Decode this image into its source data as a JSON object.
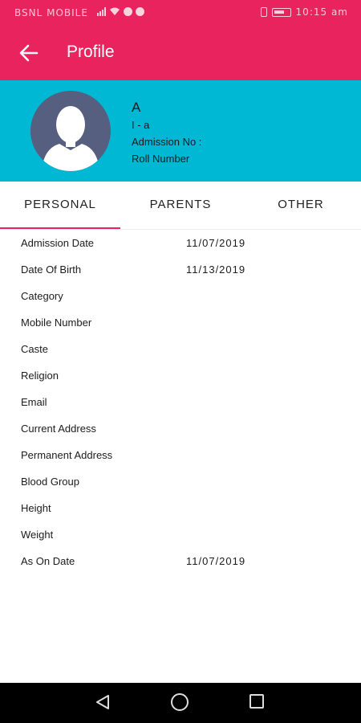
{
  "status_bar": {
    "carrier": "BSNL MOBILE",
    "time": "10:15 am",
    "icons": [
      "signal-icon",
      "wifi-icon",
      "chat-icon",
      "whatsapp-icon",
      "vibrate-icon",
      "battery-icon"
    ]
  },
  "app_bar": {
    "title": "Profile",
    "back_icon": "arrow-left-icon",
    "color": "#e8235e"
  },
  "profile": {
    "name": "A",
    "class_section": "I - a",
    "admission_no": "Admission No :",
    "roll_number": "Roll Number",
    "avatar_icon": "user-silhouette-icon",
    "header_color": "#00b8d4"
  },
  "tabs": [
    {
      "label": "PERSONAL",
      "selected": true
    },
    {
      "label": "PARENTS",
      "selected": false
    },
    {
      "label": "OTHER",
      "selected": false
    }
  ],
  "fields": [
    {
      "label": "Admission Date",
      "value": "11/07/2019"
    },
    {
      "label": "Date Of Birth",
      "value": "11/13/2019"
    },
    {
      "label": "Category",
      "value": ""
    },
    {
      "label": "Mobile Number",
      "value": ""
    },
    {
      "label": "Caste",
      "value": ""
    },
    {
      "label": "Religion",
      "value": ""
    },
    {
      "label": "Email",
      "value": ""
    },
    {
      "label": "Current Address",
      "value": ""
    },
    {
      "label": "Permanent Address",
      "value": ""
    },
    {
      "label": "Blood Group",
      "value": ""
    },
    {
      "label": "Height",
      "value": ""
    },
    {
      "label": "Weight",
      "value": ""
    },
    {
      "label": "As On Date",
      "value": "11/07/2019"
    }
  ],
  "nav_bar": {
    "icons": [
      "triangle-back-icon",
      "circle-home-icon",
      "square-recents-icon"
    ]
  }
}
